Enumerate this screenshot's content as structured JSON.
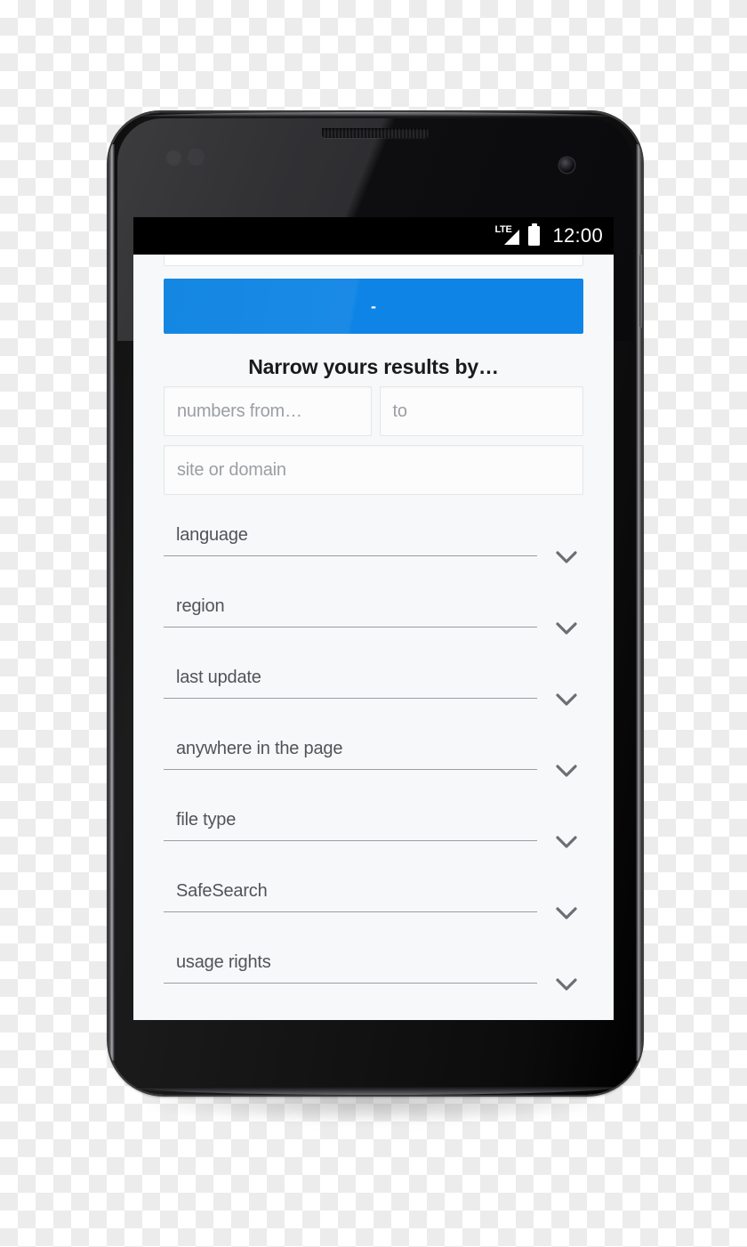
{
  "device": {
    "type": "android-smartphone",
    "frame_color": "#101010"
  },
  "status_bar": {
    "network_label": "LTE",
    "signal_icon": "signal-bars-icon",
    "battery_icon": "battery-full-icon",
    "time": "12:00"
  },
  "screen": {
    "background_color": "#f7f8fa",
    "accent_color": "#0d84e6",
    "search_button": {
      "label": "-",
      "name": "search-submit-button",
      "color": "#0d84e6"
    },
    "section_title": "Narrow yours results by…",
    "fields": [
      {
        "name": "numbers-from-field",
        "placeholder": "numbers from…",
        "value": ""
      },
      {
        "name": "numbers-to-field",
        "placeholder": "to",
        "value": ""
      },
      {
        "name": "site-or-domain-field",
        "placeholder": "site or domain",
        "value": ""
      }
    ],
    "dropdowns": [
      {
        "name": "language-dropdown",
        "label": "language",
        "icon": "chevron-down-icon"
      },
      {
        "name": "region-dropdown",
        "label": "region",
        "icon": "chevron-down-icon"
      },
      {
        "name": "last-update-dropdown",
        "label": "last update",
        "icon": "chevron-down-icon"
      },
      {
        "name": "terms-location-dropdown",
        "label": "anywhere in the page",
        "icon": "chevron-down-icon"
      },
      {
        "name": "file-type-dropdown",
        "label": "file type",
        "icon": "chevron-down-icon"
      },
      {
        "name": "safesearch-dropdown",
        "label": "SafeSearch",
        "icon": "chevron-down-icon"
      },
      {
        "name": "usage-rights-dropdown",
        "label": "usage rights",
        "icon": "chevron-down-icon"
      }
    ]
  }
}
